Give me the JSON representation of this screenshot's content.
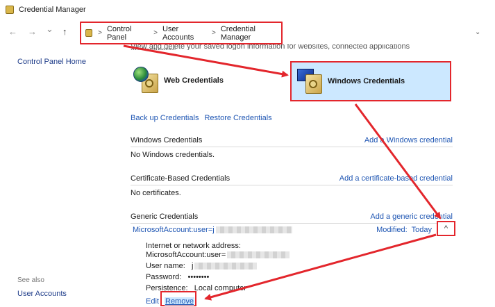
{
  "window": {
    "title": "Credential Manager"
  },
  "nav": {
    "back": "←",
    "forward": "→",
    "recent": "⌄",
    "up": "↑",
    "dropdown": "⌄"
  },
  "breadcrumb": [
    "Control Panel",
    "User Accounts",
    "Credential Manager"
  ],
  "sidebar": {
    "home": "Control Panel Home",
    "see_also": "See also",
    "user_accounts": "User Accounts"
  },
  "intro": "View and delete your saved logon information for websites, connected applications and networks.",
  "tiles": {
    "web": "Web Credentials",
    "windows": "Windows Credentials"
  },
  "actions": {
    "backup": "Back up Credentials",
    "restore": "Restore Credentials"
  },
  "sections": {
    "windows": {
      "title": "Windows Credentials",
      "add": "Add a Windows credential",
      "empty": "No Windows credentials."
    },
    "certificate": {
      "title": "Certificate-Based Credentials",
      "add": "Add a certificate-based credential",
      "empty": "No certificates."
    },
    "generic": {
      "title": "Generic Credentials",
      "add": "Add a generic credential"
    }
  },
  "credential": {
    "name": "MicrosoftAccount:user=j",
    "modified_label": "Modified:",
    "modified_value": "Today",
    "chevron": "^",
    "address_label": "Internet or network address:",
    "address_value": "MicrosoftAccount:user=",
    "username_label": "User name:",
    "username_value": "j",
    "password_label": "Password:",
    "password_value": "••••••••",
    "persistence_label": "Persistence:",
    "persistence_value": "Local computer",
    "edit": "Edit",
    "remove": "Remove"
  },
  "colors": {
    "highlight": "#e3262c",
    "selection": "#cce8ff",
    "link": "#1f56b3"
  }
}
